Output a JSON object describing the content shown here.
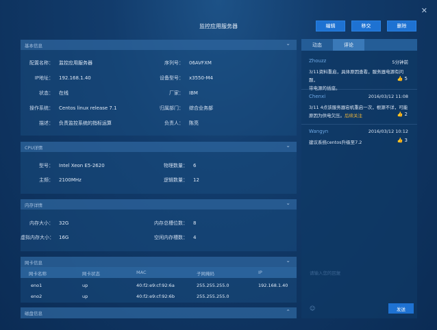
{
  "window": {
    "title": "监控应用服务器",
    "close_icon": "✕"
  },
  "actions": {
    "edit": "编辑",
    "transfer": "移交",
    "delete": "删除"
  },
  "basic": {
    "title": "基本信息",
    "left": [
      {
        "label": "配置名称：",
        "value": "监控应用服务器"
      },
      {
        "label": "IP地址：",
        "value": "192.168.1.40"
      },
      {
        "label": "状态：",
        "value": "在线"
      },
      {
        "label": "操作系统：",
        "value": "Centos linux release 7.1"
      },
      {
        "label": "描述：",
        "value": "负责监控系统的指标运算"
      }
    ],
    "right": [
      {
        "label": "序列号：",
        "value": "06AVFXM"
      },
      {
        "label": "设备型号：",
        "value": "x3550-M4"
      },
      {
        "label": "厂家：",
        "value": "IBM"
      },
      {
        "label": "归属部门：",
        "value": "综合业务部"
      },
      {
        "label": "负责人：",
        "value": "陈亮"
      }
    ]
  },
  "cpu": {
    "title": "CPU详情",
    "left": [
      {
        "label": "型号：",
        "value": "Intel Xeon E5-2620"
      },
      {
        "label": "主频：",
        "value": "2100MHz"
      }
    ],
    "right": [
      {
        "label": "物理数量：",
        "value": "6"
      },
      {
        "label": "逻辑数量：",
        "value": "12"
      }
    ]
  },
  "memory": {
    "title": "内存详情",
    "left": [
      {
        "label": "内存大小：",
        "value": "32G"
      },
      {
        "label": "虚拟内存大小：",
        "value": "16G"
      }
    ],
    "right": [
      {
        "label": "内存总槽位数：",
        "value": "8"
      },
      {
        "label": "空闲内存槽数：",
        "value": "4"
      }
    ]
  },
  "nic": {
    "title": "网卡信息",
    "headers": [
      "网卡名称",
      "网卡状态",
      "MAC",
      "子网掩码",
      "IP"
    ],
    "rows": [
      [
        "eno1",
        "up",
        "40:f2:e9:cf:92:6a",
        "255.255.255.0",
        "192.168.1.40"
      ],
      [
        "eno2",
        "up",
        "40:f2:e9:cf:92:6b",
        "255.255.255.0",
        ""
      ]
    ]
  },
  "disk": {
    "title": "磁盘信息"
  },
  "panel": {
    "tabs": [
      "动态",
      "评论"
    ],
    "active_tab": 1,
    "comments": [
      {
        "user": "Zhouzz",
        "date": "5分钟前",
        "text_a": "3/11资料重启，具体原因查看，服务器电源有问题，",
        "text_b": "带电源的插座。",
        "highlight": "",
        "likes": "5"
      },
      {
        "user": "Chenxi",
        "date": "2016/03/12  11:08",
        "text_a": "3/11 4点该服务器宕机重启一次，根源不详，可能",
        "text_b": "原因为供电欠压。",
        "highlight": "后续关注",
        "likes": "2"
      },
      {
        "user": "Wangyn",
        "date": "2016/03/12  10:12",
        "text_a": "建议系统centos升级至7.2",
        "text_b": "",
        "highlight": "",
        "likes": "3"
      }
    ],
    "reply_placeholder": "请输入您的回复",
    "emoji_icon": "☺",
    "send": "发送"
  },
  "colors": {
    "accent": "#1e72d2",
    "user": "#6ea9e6",
    "highlight": "#e8b23a"
  }
}
